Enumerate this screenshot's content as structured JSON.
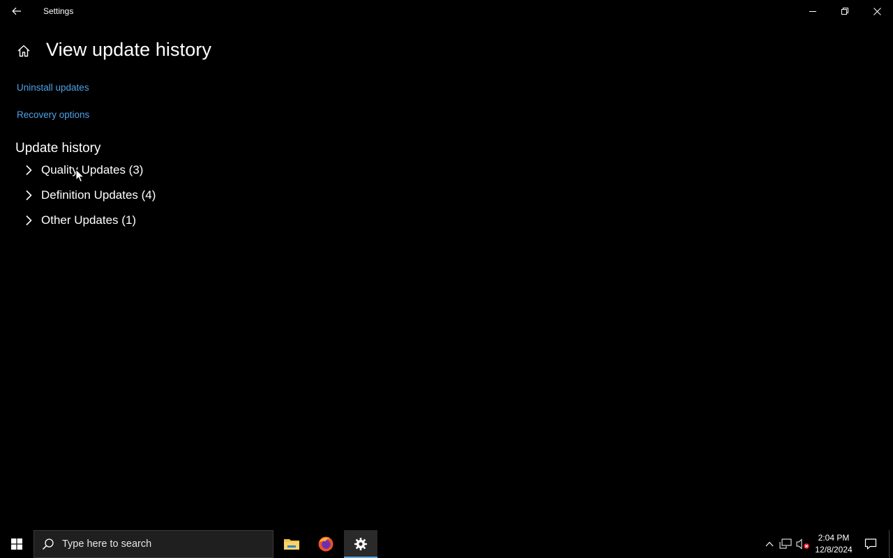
{
  "window": {
    "title": "Settings"
  },
  "page": {
    "title": "View update history",
    "links": [
      {
        "label": "Uninstall updates"
      },
      {
        "label": "Recovery options"
      }
    ],
    "section_title": "Update history",
    "groups": [
      {
        "label": "Quality Updates (3)"
      },
      {
        "label": "Definition Updates (4)"
      },
      {
        "label": "Other Updates (1)"
      }
    ]
  },
  "taskbar": {
    "search_placeholder": "Type here to search",
    "apps": [
      "file-explorer",
      "firefox",
      "settings"
    ],
    "active_app": "settings",
    "time": "2:04 PM",
    "date": "12/8/2024"
  },
  "colors": {
    "background": "#000000",
    "link": "#4ea1e8",
    "accent": "#5aa7e6"
  },
  "icons": {
    "back": "back-arrow-icon",
    "home": "home-icon",
    "expand": "chevron-right-icon",
    "start": "windows-logo-icon",
    "search": "search-icon",
    "notification": "action-center-icon"
  }
}
